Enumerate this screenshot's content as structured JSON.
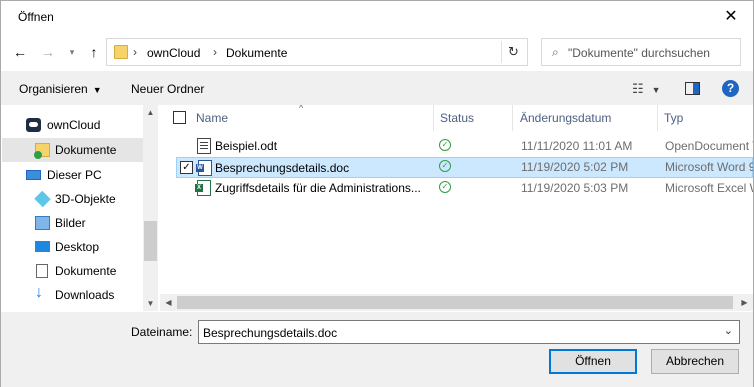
{
  "window": {
    "title": "Öffnen"
  },
  "address": {
    "crumbs": [
      "ownCloud",
      "Dokumente"
    ]
  },
  "search": {
    "placeholder": "\"Dokumente\" durchsuchen"
  },
  "toolbar": {
    "organize_label": "Organisieren",
    "new_folder_label": "Neuer Ordner"
  },
  "sidebar": {
    "items": [
      {
        "label": "ownCloud",
        "icon": "cloud-icon"
      },
      {
        "label": "Dokumente",
        "icon": "folder-icon",
        "selected": true
      },
      {
        "label": "Dieser PC",
        "icon": "computer-icon"
      },
      {
        "label": "3D-Objekte",
        "icon": "cube-icon"
      },
      {
        "label": "Bilder",
        "icon": "pictures-icon"
      },
      {
        "label": "Desktop",
        "icon": "desktop-icon"
      },
      {
        "label": "Dokumente",
        "icon": "documents-icon"
      },
      {
        "label": "Downloads",
        "icon": "download-icon"
      }
    ]
  },
  "list": {
    "columns": [
      "Name",
      "Status",
      "Änderungsdatum",
      "Typ"
    ],
    "rows": [
      {
        "name": "Beispiel.odt",
        "date": "11/11/2020 11:01 AM",
        "type": "OpenDocument T",
        "icon": "odt-file-icon",
        "selected": false
      },
      {
        "name": "Besprechungsdetails.doc",
        "date": "11/19/2020 5:02 PM",
        "type": "Microsoft Word 9",
        "icon": "word-file-icon",
        "selected": true
      },
      {
        "name": "Zugriffsdetails für die Administrations...",
        "date": "11/19/2020 5:03 PM",
        "type": "Microsoft Excel W",
        "icon": "excel-file-icon",
        "selected": false
      }
    ]
  },
  "footer": {
    "filename_label": "Dateiname:",
    "filename_value": "Besprechungsdetails.doc",
    "open_label": "Öffnen",
    "cancel_label": "Abbrechen"
  },
  "colors": {
    "accent": "#0078d7",
    "selection": "#cce8ff",
    "status_ok": "#2f9e44"
  }
}
